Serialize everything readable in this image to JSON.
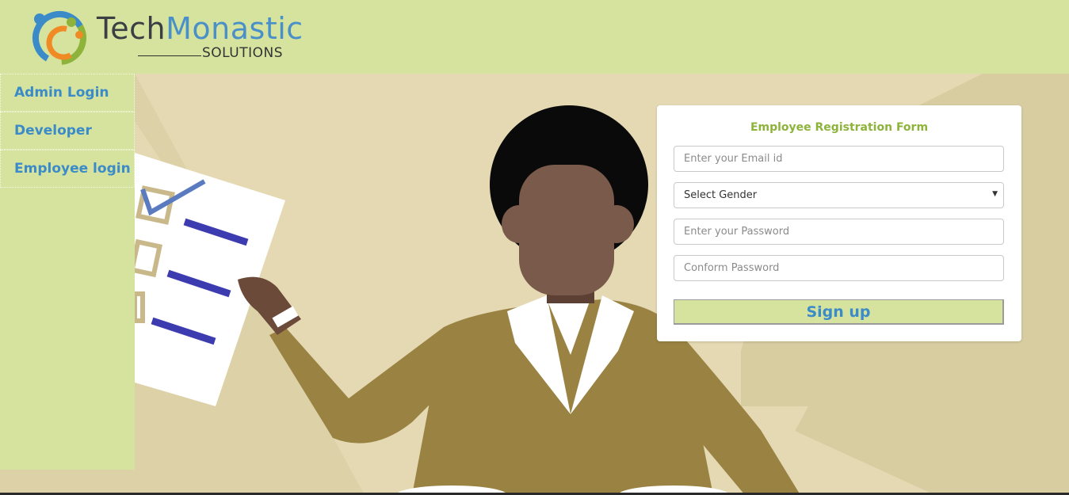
{
  "brand": {
    "name_part1": "Tech",
    "name_part2": "Monastic",
    "subtitle": "SOLUTIONS"
  },
  "sidebar": {
    "items": [
      {
        "label": "Admin Login"
      },
      {
        "label": "Developer"
      },
      {
        "label": "Employee login"
      }
    ]
  },
  "form": {
    "title": "Employee Registration Form",
    "email_placeholder": "Enter your Email id",
    "gender_selected": "Select Gender",
    "password_placeholder": "Enter your Password",
    "confirm_placeholder": "Conform Password",
    "submit_label": "Sign up"
  },
  "colors": {
    "header_bg": "#d6e39e",
    "link_blue": "#3a8bc8",
    "title_green": "#8db33a",
    "hero_bg": "#ddd1a8",
    "shirt": "#9a8342",
    "skin": "#7a5a4a"
  }
}
